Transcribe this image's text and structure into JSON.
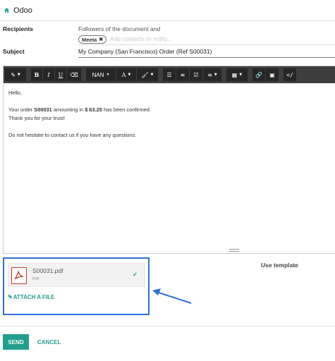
{
  "window": {
    "title": "Odoo"
  },
  "recipients": {
    "label": "Recipients",
    "text": "Followers of the document and",
    "tag": "Meeta",
    "placeholder": "Add contacts to notify..."
  },
  "subject": {
    "label": "Subject",
    "value": "My Company (San Francisco) Order (Ref S00031)"
  },
  "toolbar": {
    "font_label": "NAN",
    "color_label": "A"
  },
  "body": {
    "greeting": "Hello,",
    "line1_pre": "Your order ",
    "order_ref": "S00031",
    "line1_mid": " amounting in ",
    "amount": "$ 63.25",
    "line1_post": " has been confirmed.",
    "line2": "Thank you for your trust!",
    "line3": "Do not hesitate to contact us if you have any questions."
  },
  "attachment": {
    "file_name": "S00031.pdf",
    "file_type": "PDF",
    "attach_label": "ATTACH A FILE"
  },
  "template_label": "Use template",
  "actions": {
    "send": "SEND",
    "cancel": "CANCEL"
  },
  "colors": {
    "accent": "#21a08f",
    "highlight": "#2f6fd6",
    "pdf_red": "#c0392b",
    "check": "#28a745"
  }
}
